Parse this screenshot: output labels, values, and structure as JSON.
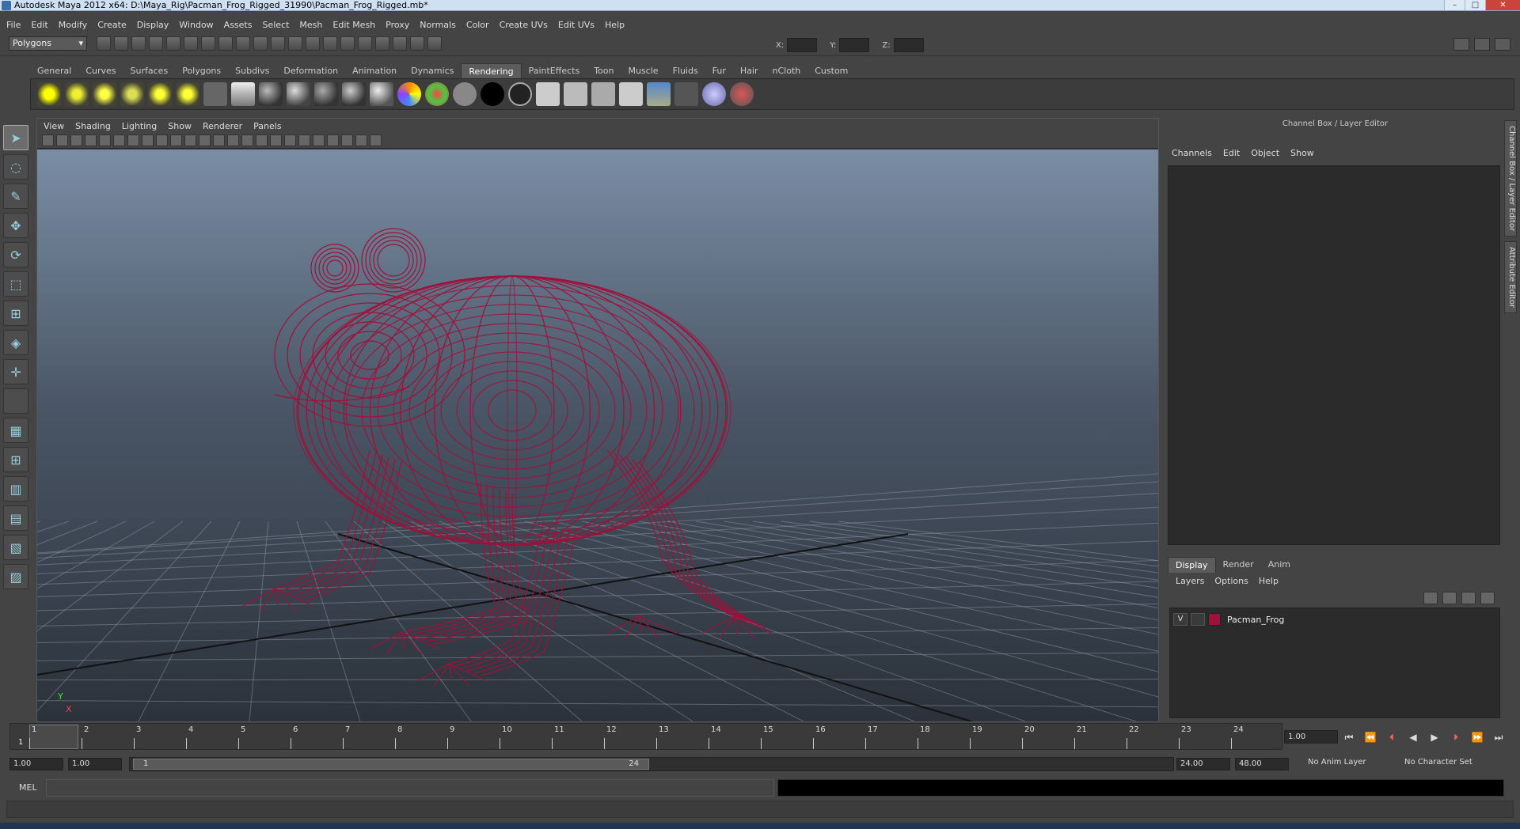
{
  "window": {
    "title": "Autodesk Maya 2012 x64: D:\\Maya_Rig\\Pacman_Frog_Rigged_31990\\Pacman_Frog_Rigged.mb*"
  },
  "menubar": [
    "File",
    "Edit",
    "Modify",
    "Create",
    "Display",
    "Window",
    "Assets",
    "Select",
    "Mesh",
    "Edit Mesh",
    "Proxy",
    "Normals",
    "Color",
    "Create UVs",
    "Edit UVs",
    "Help"
  ],
  "statusline": {
    "mode": "Polygons",
    "x_label": "X:",
    "y_label": "Y:",
    "z_label": "Z:"
  },
  "shelf": {
    "tabs": [
      "General",
      "Curves",
      "Surfaces",
      "Polygons",
      "Subdivs",
      "Deformation",
      "Animation",
      "Dynamics",
      "Rendering",
      "PaintEffects",
      "Toon",
      "Muscle",
      "Fluids",
      "Fur",
      "Hair",
      "nCloth",
      "Custom"
    ],
    "active_tab": "Rendering"
  },
  "viewport": {
    "menu": [
      "View",
      "Shading",
      "Lighting",
      "Show",
      "Renderer",
      "Panels"
    ],
    "axis_y": "Y",
    "axis_x": "X",
    "wire_color": "#a0103a"
  },
  "channel_box": {
    "header": "Channel Box / Layer Editor",
    "menu": [
      "Channels",
      "Edit",
      "Object",
      "Show"
    ]
  },
  "side_tabs": [
    "Channel Box / Layer Editor",
    "Attribute Editor"
  ],
  "layer_editor": {
    "tabs": [
      "Display",
      "Render",
      "Anim"
    ],
    "active_tab": "Display",
    "menu": [
      "Layers",
      "Options",
      "Help"
    ],
    "layers": [
      {
        "visible": "V",
        "name": "Pacman_Frog",
        "color": "#a0103a"
      }
    ]
  },
  "timeline": {
    "ticks": [
      "1",
      "2",
      "3",
      "4",
      "5",
      "6",
      "7",
      "8",
      "9",
      "10",
      "11",
      "12",
      "13",
      "14",
      "15",
      "16",
      "17",
      "18",
      "19",
      "20",
      "21",
      "22",
      "23",
      "24"
    ],
    "current_frame": "1",
    "current_frame_field": "1.00"
  },
  "range": {
    "start_time": "1.00",
    "playback_start": "1.00",
    "range_start_label": "1",
    "range_end_label": "24",
    "playback_end": "24.00",
    "end_time": "48.00",
    "anim_layer": "No Anim Layer",
    "character_set": "No Character Set"
  },
  "command_line": {
    "label": "MEL"
  }
}
